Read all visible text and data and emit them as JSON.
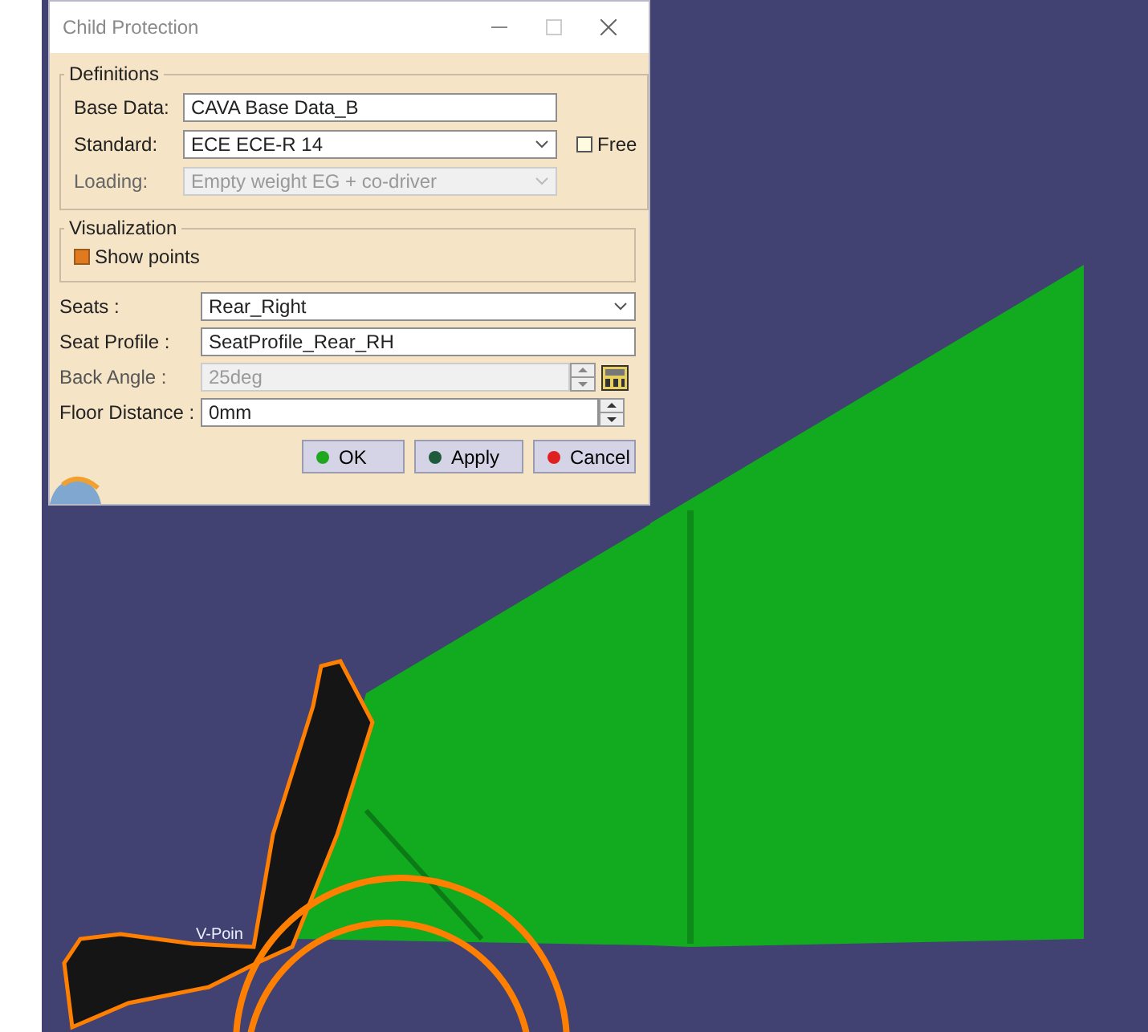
{
  "window": {
    "title": "Child Protection"
  },
  "definitions": {
    "title": "Definitions",
    "base_data": {
      "label": "Base Data:",
      "value": "CAVA Base Data_B"
    },
    "standard": {
      "label": "Standard:",
      "value": "ECE ECE-R 14"
    },
    "free": {
      "label": "Free",
      "checked": false
    },
    "loading": {
      "label": "Loading:",
      "value": "Empty weight EG + co-driver",
      "disabled": true
    }
  },
  "visualization": {
    "title": "Visualization",
    "show_points": {
      "label": "Show points",
      "checked": true
    }
  },
  "fields": [
    {
      "kind": "combo",
      "label": "Seats :",
      "value": "Rear_Right",
      "disabled": false
    },
    {
      "kind": "text",
      "label": "Seat Profile :",
      "value": "SeatProfile_Rear_RH",
      "disabled": false
    },
    {
      "kind": "spinner",
      "label": "Back Angle :",
      "value": "25deg",
      "disabled": true
    },
    {
      "kind": "spinner",
      "label": "Floor Distance :",
      "value": "0mm",
      "disabled": false
    }
  ],
  "buttons": [
    {
      "label": "OK",
      "color": "#1fa81f"
    },
    {
      "label": "Apply",
      "color": "#1f5a3a"
    },
    {
      "label": "Cancel",
      "color": "#e02020"
    }
  ],
  "scene": {
    "point_label": "V-Poin"
  }
}
